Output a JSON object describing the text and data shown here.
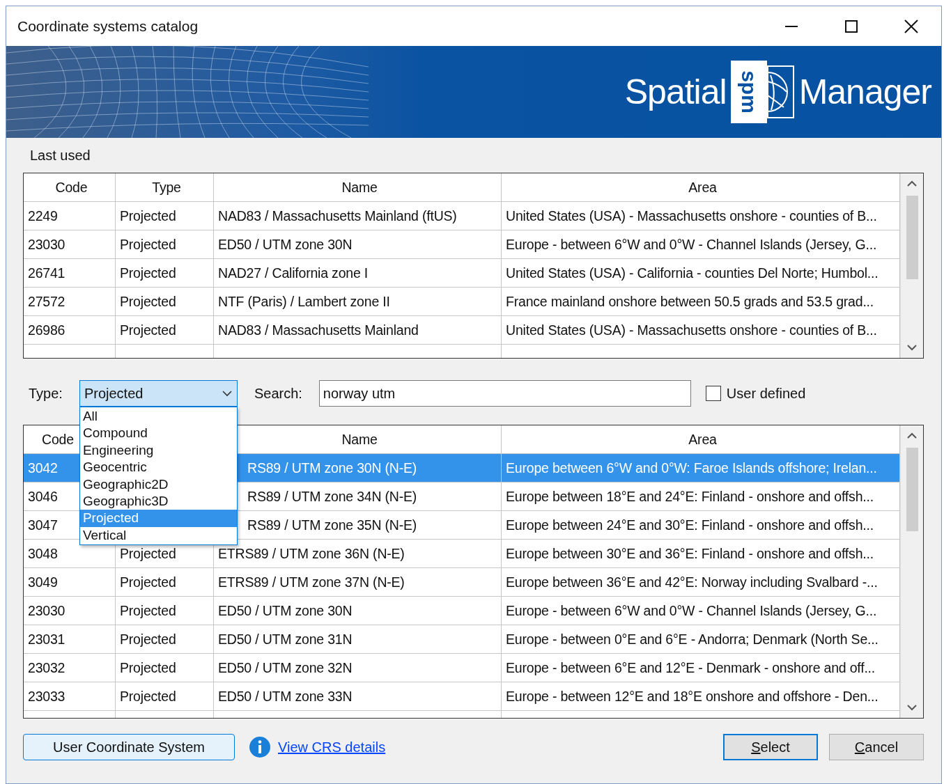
{
  "window": {
    "title": "Coordinate systems catalog"
  },
  "banner": {
    "logo_left": "Spatial",
    "logo_mark": "spm",
    "logo_right": "Manager"
  },
  "last_used": {
    "label": "Last used",
    "columns": [
      "Code",
      "Type",
      "Name",
      "Area"
    ],
    "rows": [
      {
        "code": "2249",
        "type": "Projected",
        "name": "NAD83 / Massachusetts Mainland (ftUS)",
        "area": "United States (USA) - Massachusetts onshore - counties of B..."
      },
      {
        "code": "23030",
        "type": "Projected",
        "name": "ED50 / UTM zone 30N",
        "area": "Europe - between 6°W and 0°W - Channel Islands (Jersey, G..."
      },
      {
        "code": "26741",
        "type": "Projected",
        "name": "NAD27 / California zone I",
        "area": "United States (USA) - California - counties Del Norte; Humbol..."
      },
      {
        "code": "27572",
        "type": "Projected",
        "name": "NTF (Paris) / Lambert zone II",
        "area": "France mainland onshore between 50.5 grads and 53.5 grad..."
      },
      {
        "code": "26986",
        "type": "Projected",
        "name": "NAD83 / Massachusetts Mainland",
        "area": "United States (USA) - Massachusetts onshore - counties of B..."
      }
    ]
  },
  "filters": {
    "type_label": "Type:",
    "type_value": "Projected",
    "type_options": [
      {
        "label": "All",
        "selected": false
      },
      {
        "label": "Compound",
        "selected": false
      },
      {
        "label": "Engineering",
        "selected": false
      },
      {
        "label": "Geocentric",
        "selected": false
      },
      {
        "label": "Geographic2D",
        "selected": false
      },
      {
        "label": "Geographic3D",
        "selected": false
      },
      {
        "label": "Projected",
        "selected": true
      },
      {
        "label": "Vertical",
        "selected": false
      }
    ],
    "search_label": "Search:",
    "search_value": "norway utm",
    "user_defined": {
      "label": "User defined",
      "checked": false
    }
  },
  "results": {
    "columns": [
      "Code",
      "Name",
      "Area"
    ],
    "rows": [
      {
        "code": "3042",
        "name": "RS89 / UTM zone 30N (N-E)",
        "area": "Europe between 6°W and 0°W: Faroe Islands offshore; Irelan...",
        "selected": true
      },
      {
        "code": "3046",
        "name": "RS89 / UTM zone 34N (N-E)",
        "area": "Europe between 18°E and 24°E: Finland - onshore and offsh...",
        "selected": false
      },
      {
        "code": "3047",
        "name": "RS89 / UTM zone 35N (N-E)",
        "area": "Europe between 24°E and 30°E: Finland - onshore and offsh...",
        "selected": false
      },
      {
        "code": "3048",
        "type": "Projected",
        "name": "ETRS89 / UTM zone 36N (N-E)",
        "area": "Europe between 30°E and 36°E: Finland - onshore and offsh...",
        "selected": false
      },
      {
        "code": "3049",
        "type": "Projected",
        "name": "ETRS89 / UTM zone 37N (N-E)",
        "area": "Europe between 36°E and 42°E: Norway including Svalbard -...",
        "selected": false
      },
      {
        "code": "23030",
        "type": "Projected",
        "name": "ED50 / UTM zone 30N",
        "area": "Europe - between 6°W and 0°W - Channel Islands (Jersey, G...",
        "selected": false
      },
      {
        "code": "23031",
        "type": "Projected",
        "name": "ED50 / UTM zone 31N",
        "area": "Europe - between 0°E and 6°E - Andorra; Denmark (North Se...",
        "selected": false
      },
      {
        "code": "23032",
        "type": "Projected",
        "name": "ED50 / UTM zone 32N",
        "area": "Europe - between 6°E and 12°E - Denmark - onshore and off...",
        "selected": false
      },
      {
        "code": "23033",
        "type": "Projected",
        "name": "ED50 / UTM zone 33N",
        "area": "Europe - between 12°E and 18°E onshore and offshore - Den...",
        "selected": false
      }
    ]
  },
  "footer": {
    "user_cs_button": "User Coordinate System",
    "details_link": "View CRS details",
    "select_button": "Select",
    "cancel_button": "Cancel"
  }
}
